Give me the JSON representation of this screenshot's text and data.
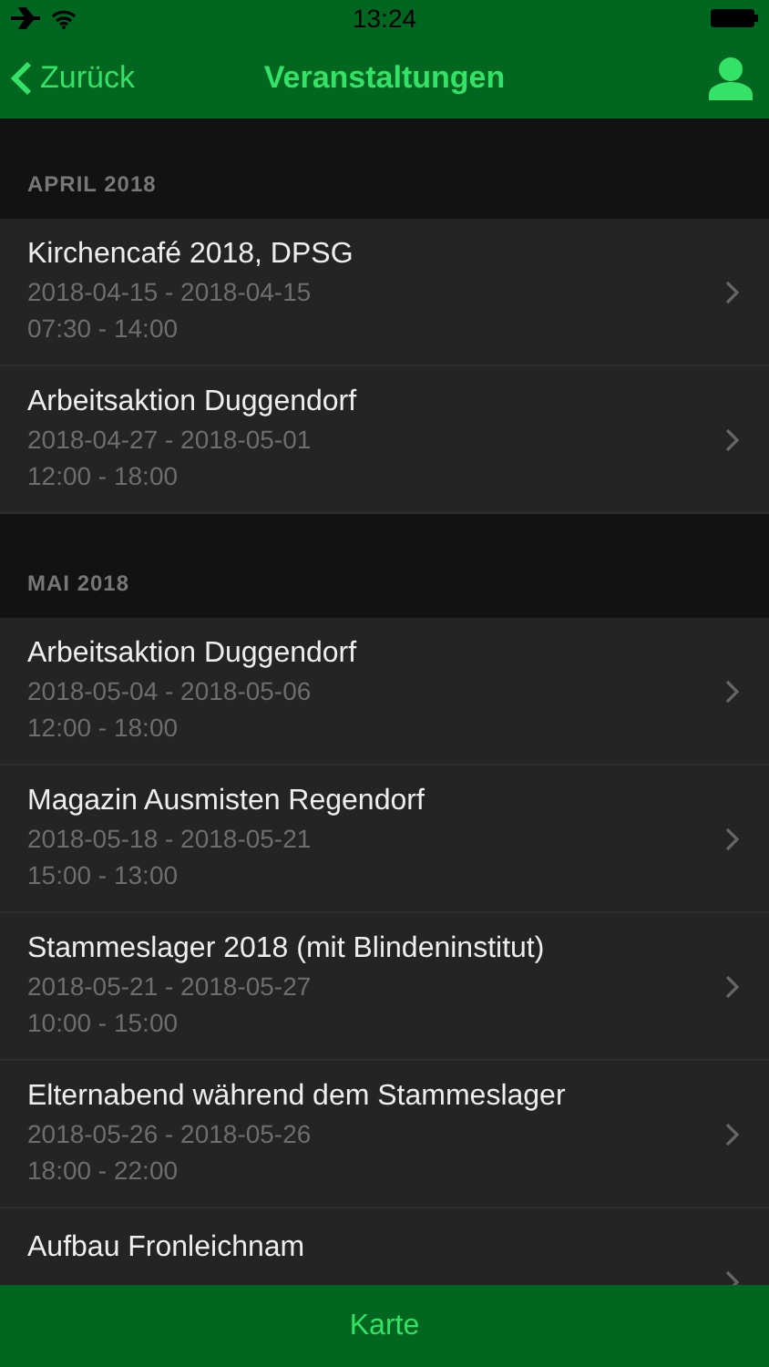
{
  "status_bar": {
    "time": "13:24"
  },
  "nav": {
    "back": "Zurück",
    "title": "Veranstaltungen"
  },
  "sections": [
    {
      "header": "APRIL 2018",
      "items": [
        {
          "title": "Kirchencafé 2018, DPSG",
          "dates": "2018-04-15 - 2018-04-15",
          "time": "07:30 - 14:00"
        },
        {
          "title": "Arbeitsaktion Duggendorf",
          "dates": "2018-04-27 - 2018-05-01",
          "time": "12:00 - 18:00"
        }
      ]
    },
    {
      "header": "MAI 2018",
      "items": [
        {
          "title": "Arbeitsaktion Duggendorf",
          "dates": "2018-05-04 - 2018-05-06",
          "time": "12:00 - 18:00"
        },
        {
          "title": "Magazin Ausmisten Regendorf",
          "dates": "2018-05-18 - 2018-05-21",
          "time": "15:00 - 13:00"
        },
        {
          "title": "Stammeslager 2018 (mit Blindeninstitut)",
          "dates": "2018-05-21 - 2018-05-27",
          "time": "10:00 - 15:00"
        },
        {
          "title": "Elternabend während dem Stammeslager",
          "dates": "2018-05-26 - 2018-05-26",
          "time": "18:00 - 22:00"
        },
        {
          "title": "Aufbau Fronleichnam"
        }
      ]
    }
  ],
  "toolbar": {
    "button": "Karte"
  }
}
